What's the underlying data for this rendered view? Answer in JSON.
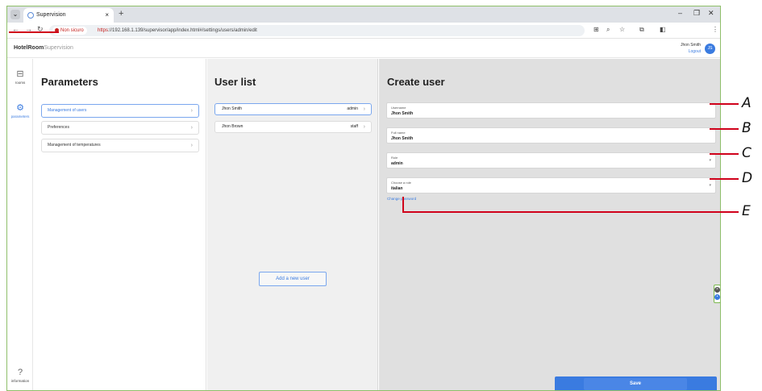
{
  "browser": {
    "tab_title": "Supervision",
    "new_tab": "+",
    "security_warning": "Non sicuro",
    "url_protocol": "https",
    "url_rest": "://192.168.1.139/supervisor/app/index.html#/settings/users/admin/edit"
  },
  "header": {
    "logo_main": "HotelRoom",
    "logo_sub": "Supervision",
    "user_name": "Jhon Smith",
    "logout": "Logout",
    "avatar_initials": "JS"
  },
  "rail": {
    "items": [
      {
        "label": "rooms",
        "icon": "bed-icon"
      },
      {
        "label": "parameters",
        "icon": "gear-icon"
      },
      {
        "label": "information",
        "icon": "help-icon"
      }
    ]
  },
  "parameters": {
    "title": "Parameters",
    "items": [
      {
        "label": "Management of users",
        "active": true
      },
      {
        "label": "Preferences",
        "active": false
      },
      {
        "label": "Management of temperatures",
        "active": false
      }
    ]
  },
  "users": {
    "title": "User list",
    "items": [
      {
        "name": "Jhon Smith",
        "role": "admin"
      },
      {
        "name": "Jhon Brown",
        "role": "staff"
      }
    ],
    "add_button": "Add a new user"
  },
  "create_user": {
    "title": "Create user",
    "fields": [
      {
        "label": "Username",
        "value": "Jhon Smith"
      },
      {
        "label": "Full name",
        "value": "Jhon Smith"
      },
      {
        "label": "Role",
        "value": "admin"
      },
      {
        "label": "Choose a role",
        "value": "italian"
      }
    ],
    "change_password": "Change password",
    "save": "Save"
  },
  "callouts": [
    "A",
    "B",
    "C",
    "D",
    "E"
  ],
  "colors": {
    "accent": "#3a7be0",
    "callout": "#d0021b"
  }
}
